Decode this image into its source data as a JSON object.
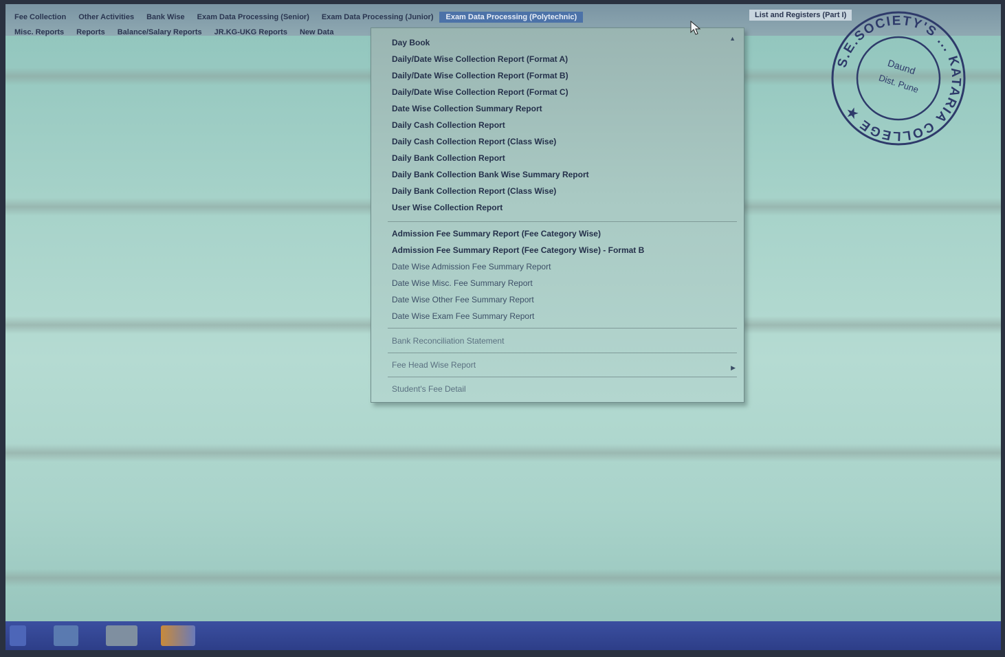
{
  "menubar": {
    "row1": [
      {
        "label": "Fee Collection"
      },
      {
        "label": "Other Activities"
      },
      {
        "label": "Bank Wise"
      },
      {
        "label": "Exam Data Processing (Senior)"
      },
      {
        "label": "Exam Data Processing (Junior)"
      },
      {
        "label": "Exam Data Processing (Polytechnic)"
      }
    ],
    "row1_right": "List and Registers (Part I)",
    "row2": [
      {
        "label": "Misc. Reports"
      },
      {
        "label": "Reports"
      },
      {
        "label": "Balance/Salary Reports"
      },
      {
        "label": "JR.KG-UKG Reports"
      },
      {
        "label": "New Data"
      }
    ]
  },
  "dropdown": {
    "group1": [
      "Day Book",
      "Daily/Date Wise Collection Report (Format A)",
      "Daily/Date Wise Collection Report (Format B)",
      "Daily/Date Wise Collection Report (Format C)",
      "Date Wise Collection Summary Report",
      "Daily Cash Collection Report",
      "Daily Cash Collection Report (Class Wise)",
      "Daily Bank Collection Report",
      "Daily Bank Collection Bank Wise Summary Report",
      "Daily Bank Collection Report (Class Wise)",
      "User Wise Collection Report"
    ],
    "group2": [
      "Admission Fee Summary Report (Fee Category Wise)",
      "Admission Fee Summary Report (Fee Category Wise) - Format B",
      "Date Wise Admission Fee Summary Report",
      "Date Wise Misc. Fee Summary Report",
      "Date Wise Other Fee Summary Report",
      "Date Wise Exam Fee Summary Report"
    ],
    "group3": [
      "Bank Reconciliation Statement"
    ],
    "group4": [
      "Fee Head Wise Report"
    ],
    "group5": [
      "Student's Fee Detail"
    ]
  },
  "stamp": {
    "ring_text": "S.E.SOCIETY'S ... KATARIA COLLEGE",
    "center_line1": "Daund",
    "center_line2": "Dist. Pune"
  },
  "colors": {
    "screen_bg": "#a6d2c9",
    "menu_active": "#4c72a8",
    "taskbar": "#2d3e88",
    "stamp_ink": "#2e3a6a"
  }
}
